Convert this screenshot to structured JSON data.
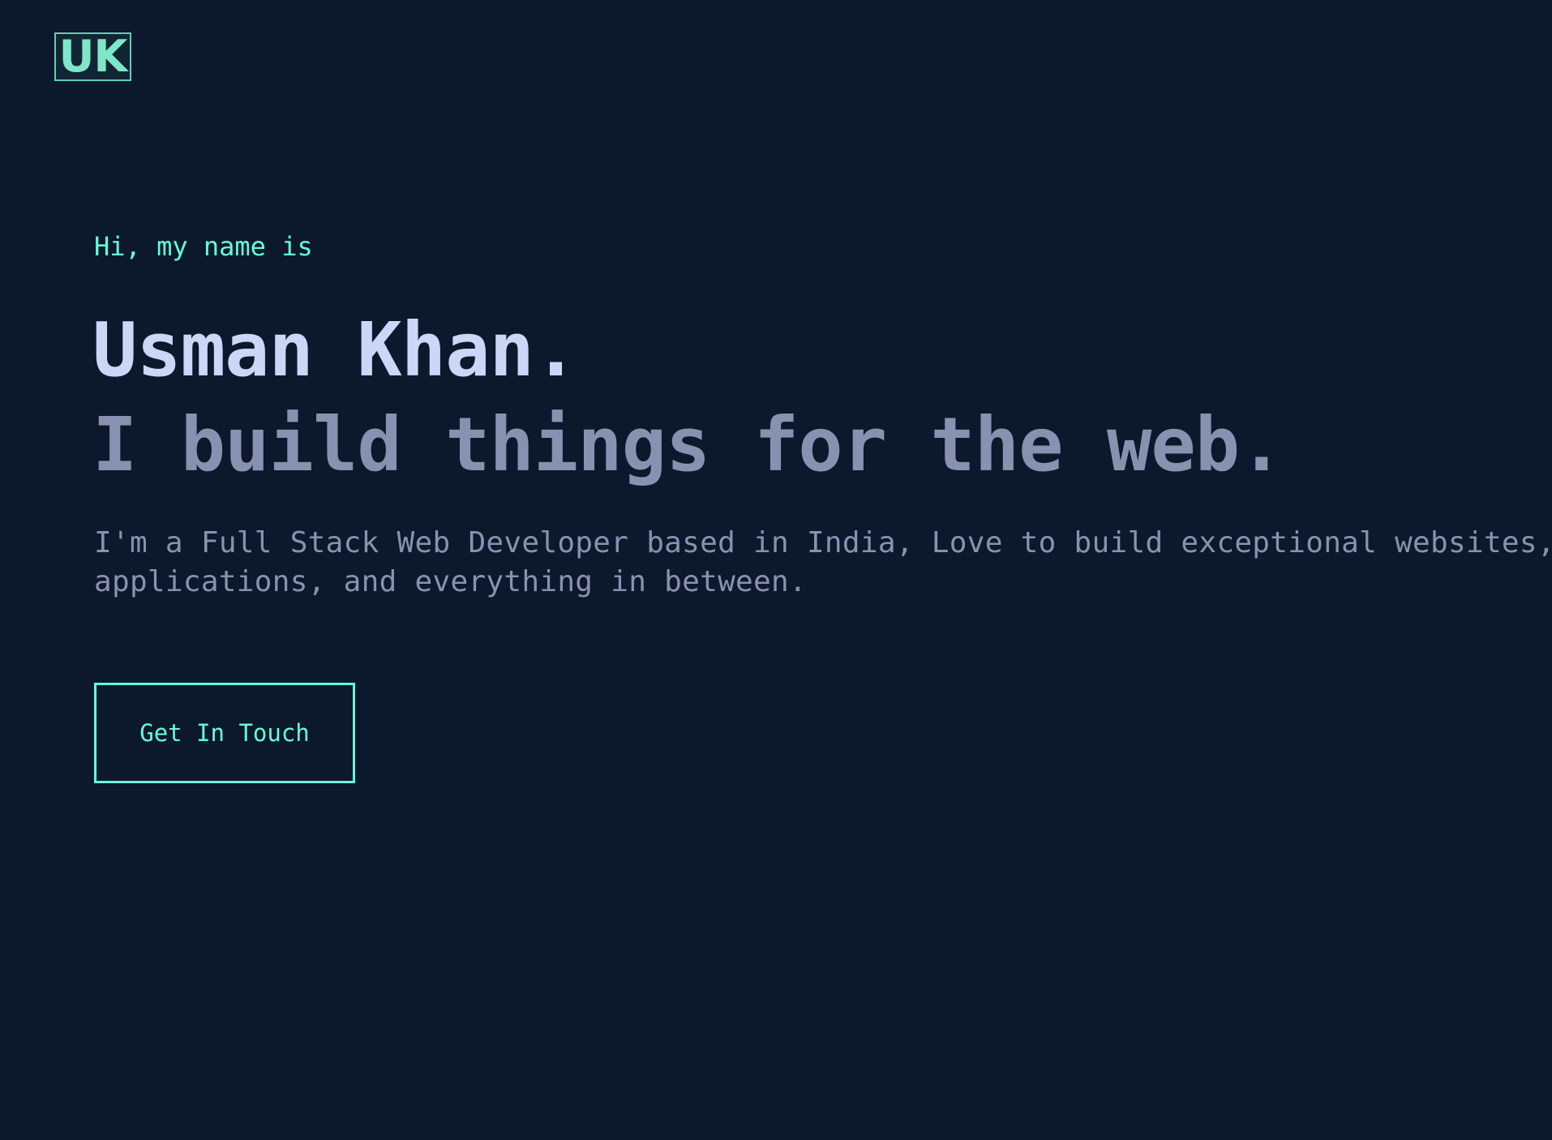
{
  "header": {
    "logo_text": "UK"
  },
  "hero": {
    "greeting": "Hi, my name is",
    "name": "Usman Khan.",
    "tagline": "I build things for the web.",
    "bio_line1": "I'm a Full Stack Web Developer based in India, Love to build exceptional websites,",
    "bio_line2": "applications, and everything in between.",
    "cta_label": "Get In Touch"
  },
  "colors": {
    "background": "#0c182b",
    "accent": "#64ffda",
    "heading": "#ccd6f6",
    "muted": "#8892b0"
  }
}
